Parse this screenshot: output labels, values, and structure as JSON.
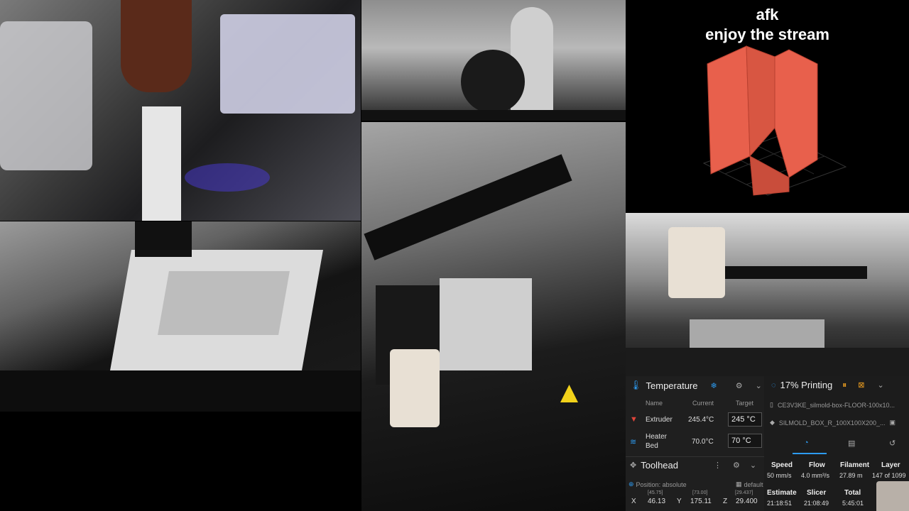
{
  "overlay": {
    "line1": "afk",
    "line2": "enjoy the stream"
  },
  "temperature": {
    "title": "Temperature",
    "col_name": "Name",
    "col_current": "Current",
    "col_target": "Target",
    "extruder_label": "Extruder",
    "extruder_current": "245.4°C",
    "extruder_target": "245",
    "extruder_unit": "°C",
    "bed_label_1": "Heater",
    "bed_label_2": "Bed",
    "bed_current": "70.0°C",
    "bed_target": "70",
    "bed_unit": "°C"
  },
  "toolhead": {
    "title": "Toolhead",
    "position_label": "Position: absolute",
    "default_label": "default",
    "x_label": "X",
    "x_raw": "[45.75]",
    "x_value": "46.13",
    "y_label": "Y",
    "y_raw": "[73.00]",
    "y_value": "175.11",
    "z_label": "Z",
    "z_raw": "[29.437]",
    "z_value": "29.400"
  },
  "printing": {
    "status": "17% Printing",
    "progress": 0.17,
    "file1": "CE3V3KE_silmold-box-FLOOR-100x10...",
    "file2": "SILMOLD_BOX_R_100X100X200_...",
    "speed_label": "Speed",
    "speed_value": "50 mm/s",
    "flow_label": "Flow",
    "flow_value": "4.0 mm³/s",
    "filament_label": "Filament",
    "filament_value": "27.89 m",
    "layer_label": "Layer",
    "layer_value": "147 of 1099",
    "estimate_label": "Estimate",
    "estimate_value": "21:18:51",
    "slicer_label": "Slicer",
    "slicer_value": "21:08:49",
    "total_label": "Total",
    "total_value": "5:45:01"
  },
  "colors": {
    "model": "#e8604c",
    "accent": "#2d9bf0",
    "orange": "#f0a020"
  }
}
